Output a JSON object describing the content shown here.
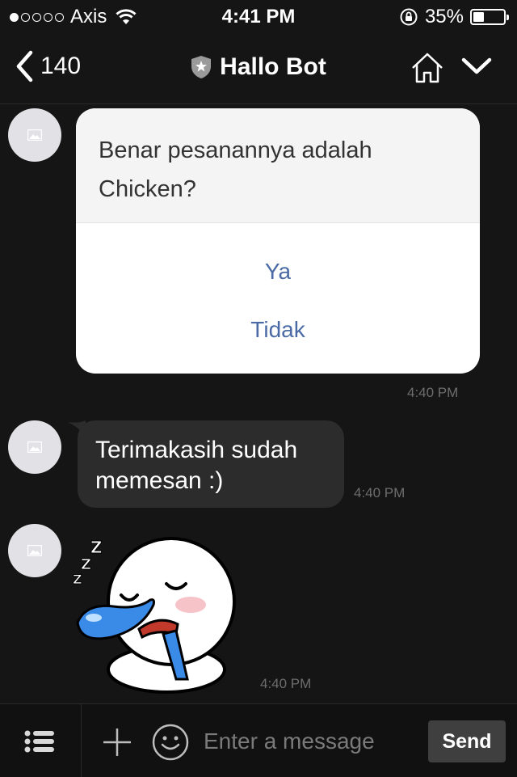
{
  "status_bar": {
    "carrier": "Axis",
    "time": "4:41 PM",
    "battery": "35%",
    "battery_level": 0.35,
    "signal_bars_filled": 1
  },
  "header": {
    "back_count": "140",
    "title": "Hallo Bot",
    "icons": [
      "chevron-left-icon",
      "shield-star-icon",
      "home-icon",
      "chevron-down-icon"
    ]
  },
  "messages": {
    "confirm_card": {
      "question": "Benar pesanannya adalah Chicken?",
      "options": [
        "Ya",
        "Tidak"
      ],
      "time": "4:40 PM"
    },
    "text_message": {
      "text": "Terimakasih sudah memesan :)",
      "time": "4:40 PM"
    },
    "sticker_message": {
      "sticker": "sleeping-character-sticker",
      "time": "4:40 PM"
    }
  },
  "input_bar": {
    "placeholder": "Enter a message",
    "value": "",
    "send_label": "Send"
  },
  "colors": {
    "background": "#151515",
    "option_text": "#4a6aa5",
    "bubble": "#2c2c2c"
  }
}
